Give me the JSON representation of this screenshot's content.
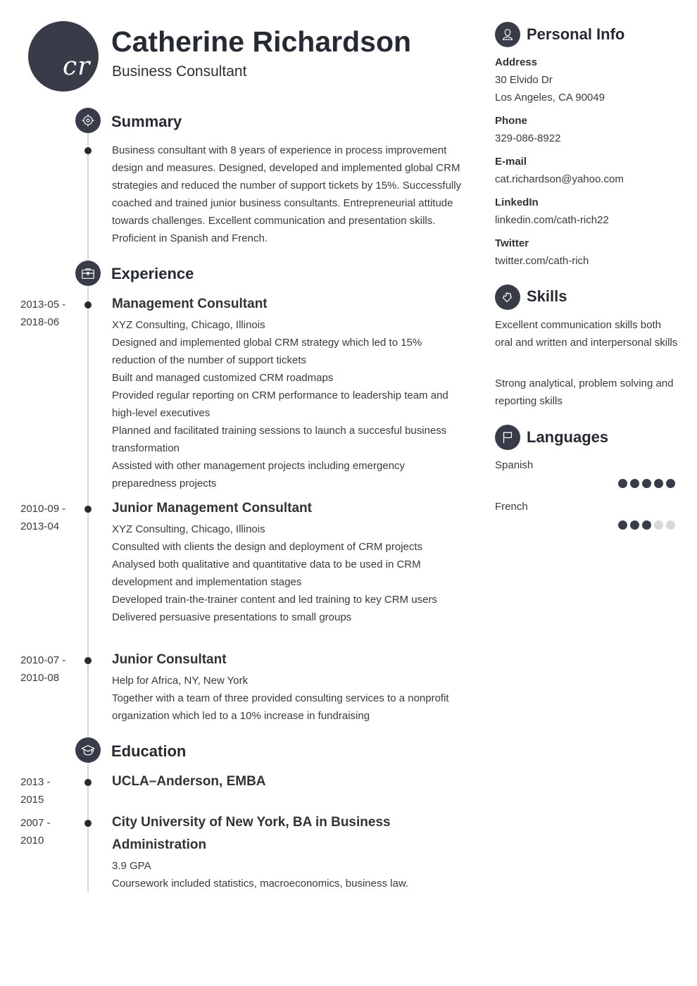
{
  "header": {
    "initials": "cr",
    "name": "Catherine Richardson",
    "title": "Business Consultant"
  },
  "colors": {
    "accent": "#373c48",
    "heading": "#262a33",
    "text": "#3a3a3a",
    "timeline": "#d6d6d6",
    "dot_off": "#d8d8d8"
  },
  "summary": {
    "heading": "Summary",
    "icon": "target-icon",
    "text": "Business consultant with 8 years of experience in process improvement design and measures. Designed, developed and implemented global CRM strategies and reduced the number of support tickets by 15%. Successfully coached and trained junior business consultants. Entrepreneurial attitude towards challenges. Excellent communication and presentation skills. Proficient in Spanish and French."
  },
  "experience": {
    "heading": "Experience",
    "icon": "briefcase-icon",
    "items": [
      {
        "dates": "2013-05 -\n2018-06",
        "title": "Management Consultant",
        "lines": [
          "XYZ Consulting, Chicago, Illinois",
          "Designed and implemented global CRM strategy which led to 15% reduction of the number of support tickets",
          "Built and managed customized CRM roadmaps",
          "Provided regular reporting on CRM performance to leadership team and high-level executives",
          "Planned and facilitated training sessions to launch a succesful business transformation",
          "Assisted with other management projects including emergency preparedness projects"
        ]
      },
      {
        "dates": "2010-09 -\n2013-04",
        "title": "Junior Management Consultant",
        "lines": [
          "XYZ Consulting, Chicago, Illinois",
          "Consulted with clients the design and deployment of CRM projects",
          "Analysed both qualitative and quantitative data to be used in CRM development and implementation stages",
          "Developed train-the-trainer content and led training to key CRM users",
          "Delivered persuasive presentations to small groups"
        ]
      },
      {
        "dates": "2010-07 -\n2010-08",
        "title": "Junior Consultant",
        "lines": [
          "Help for Africa, NY, New York",
          "Together with a team of three provided consulting services to a nonprofit organization which led to a 10% increase in fundraising"
        ]
      }
    ]
  },
  "education": {
    "heading": "Education",
    "icon": "graduation-cap-icon",
    "items": [
      {
        "dates": "2013 -\n2015",
        "title": "UCLA–Anderson, EMBA",
        "lines": []
      },
      {
        "dates": "2007 -\n2010",
        "title": "City University of New York, BA in Business Administration",
        "lines": [
          "3.9 GPA",
          "Coursework included statistics, macroeconomics, business law."
        ]
      }
    ]
  },
  "personal_info": {
    "heading": "Personal Info",
    "icon": "person-icon",
    "fields": [
      {
        "label": "Address",
        "values": [
          "30 Elvido Dr",
          "Los Angeles, CA 90049"
        ]
      },
      {
        "label": "Phone",
        "values": [
          "329-086-8922"
        ]
      },
      {
        "label": "E-mail",
        "values": [
          "cat.richardson@yahoo.com"
        ]
      },
      {
        "label": "LinkedIn",
        "values": [
          "linkedin.com/cath-rich22"
        ]
      },
      {
        "label": "Twitter",
        "values": [
          "twitter.com/cath-rich"
        ]
      }
    ]
  },
  "skills": {
    "heading": "Skills",
    "icon": "puzzle-icon",
    "items": [
      "Excellent communication skills both oral and written and interpersonal skills",
      "Strong analytical, problem solving and reporting skills"
    ]
  },
  "languages": {
    "heading": "Languages",
    "icon": "flag-icon",
    "items": [
      {
        "name": "Spanish",
        "level": 5,
        "max": 5
      },
      {
        "name": "French",
        "level": 3,
        "max": 5
      }
    ]
  }
}
